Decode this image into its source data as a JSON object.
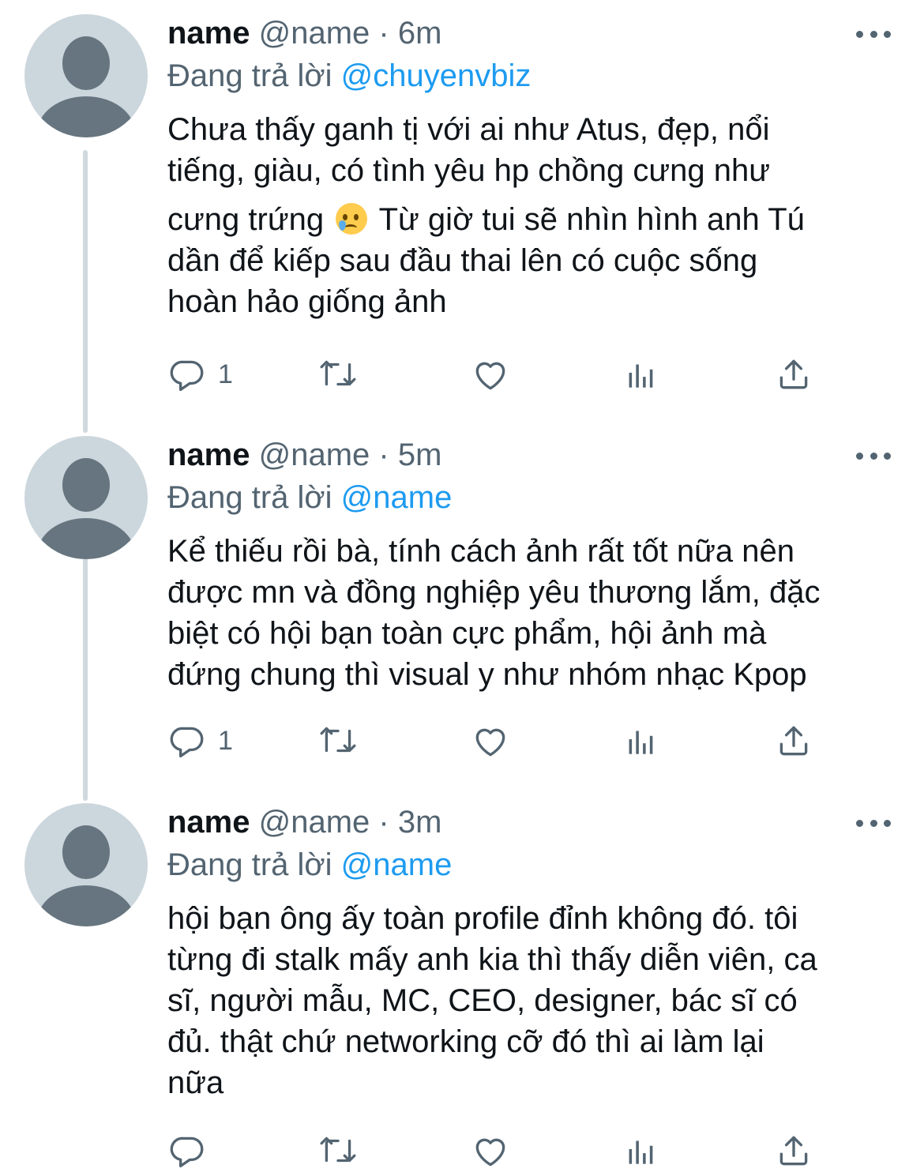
{
  "colors": {
    "accent": "#1d9bf0",
    "text_primary": "#0f1419",
    "text_secondary": "#536471",
    "thread_line": "#cfd9de",
    "avatar_bg": "#ccd6dd",
    "avatar_figure": "#66757f"
  },
  "tweets": [
    {
      "name": "name",
      "handle": "@name",
      "separator": "·",
      "time": "6m",
      "reply_prefix": "Đang trả lời",
      "reply_to": "@chuyenvbiz",
      "body_lines": [
        "Chưa thấy ganh tị với ai như Atus, đẹp, nổi",
        "tiếng, giàu, có tình yêu hp chồng cưng như",
        "cưng trứng",
        " Từ giờ tui sẽ nhìn hình anh Tú",
        "dần để kiếp sau đầu thai lên có cuộc sống",
        "hoàn hảo giống ảnh"
      ],
      "emoji": "crying-face",
      "reply_count": "1",
      "icons": [
        "reply-icon",
        "retweet-icon",
        "like-icon",
        "analytics-icon",
        "share-icon",
        "more-icon"
      ]
    },
    {
      "name": "name",
      "handle": "@name",
      "separator": "·",
      "time": "5m",
      "reply_prefix": "Đang trả lời",
      "reply_to": "@name",
      "body_lines": [
        "Kể thiếu rồi bà, tính cách ảnh rất tốt nữa nên",
        "được mn và đồng nghiệp yêu thương lắm, đặc",
        "biệt có hội bạn toàn cực phẩm, hội ảnh mà",
        "đứng chung thì visual y như nhóm nhạc Kpop"
      ],
      "reply_count": "1",
      "icons": [
        "reply-icon",
        "retweet-icon",
        "like-icon",
        "analytics-icon",
        "share-icon",
        "more-icon"
      ]
    },
    {
      "name": "name",
      "handle": "@name",
      "separator": "·",
      "time": "3m",
      "reply_prefix": "Đang trả lời",
      "reply_to": "@name",
      "body_lines": [
        "hội bạn ông ấy toàn profile đỉnh không đó. tôi",
        "từng đi stalk mấy anh kia thì thấy diễn viên, ca",
        "sĩ, người mẫu, MC, CEO, designer, bác sĩ có",
        "đủ. thật chứ networking cỡ đó thì ai làm lại",
        "nữa"
      ],
      "reply_count": "",
      "icons": [
        "reply-icon",
        "retweet-icon",
        "like-icon",
        "analytics-icon",
        "share-icon",
        "more-icon"
      ]
    }
  ]
}
